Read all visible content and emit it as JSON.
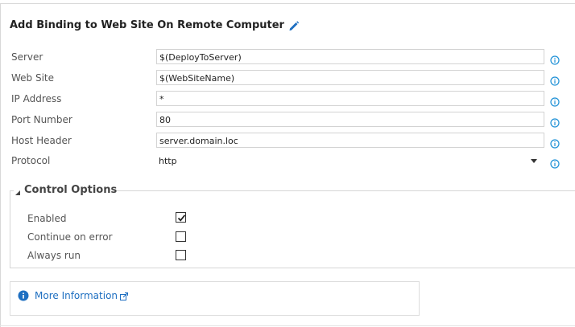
{
  "title": "Add Binding to Web Site On Remote Computer",
  "fields": [
    {
      "label": "Server",
      "value": "$(DeployToServer)"
    },
    {
      "label": "Web Site",
      "value": "$(WebSiteName)"
    },
    {
      "label": "IP Address",
      "value": "*"
    },
    {
      "label": "Port Number",
      "value": "80"
    },
    {
      "label": "Host Header",
      "value": "server.domain.loc"
    },
    {
      "label": "Protocol",
      "value": "http"
    }
  ],
  "control_options": {
    "heading": "Control Options",
    "items": [
      {
        "label": "Enabled",
        "checked": true
      },
      {
        "label": "Continue on error",
        "checked": false
      },
      {
        "label": "Always run",
        "checked": false
      }
    ]
  },
  "more_information": {
    "label": "More Information"
  },
  "colors": {
    "accent": "#1e6fc1",
    "info_icon": "#1e90d6"
  }
}
